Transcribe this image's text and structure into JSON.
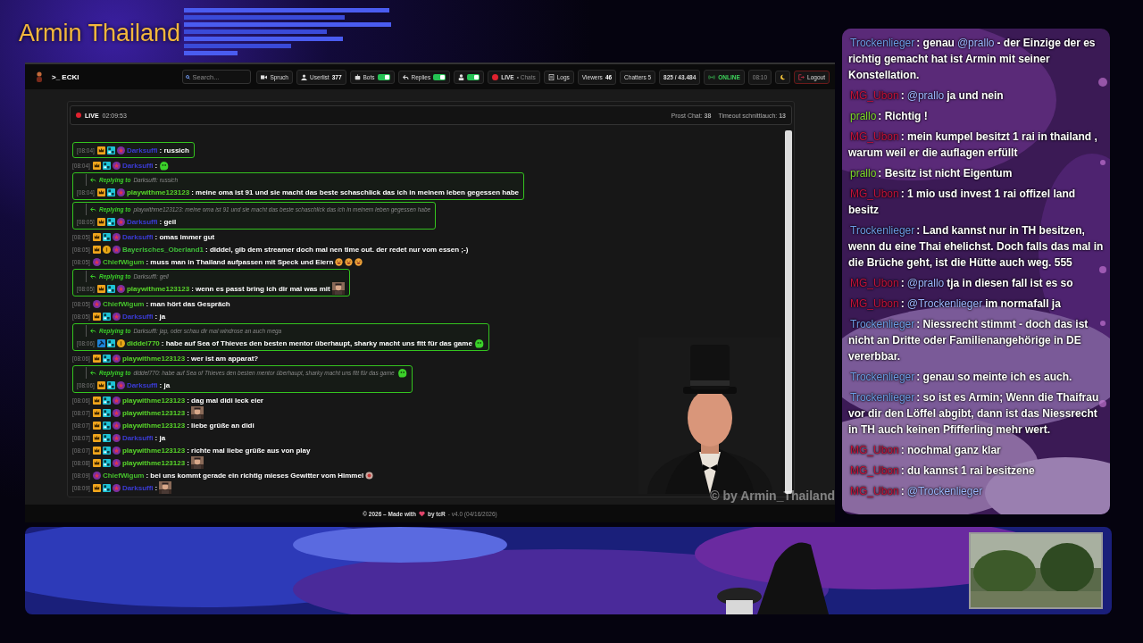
{
  "overlay_title": "Armin Thailand",
  "app": {
    "brand": ">_ ECKI",
    "search": {
      "placeholder": "Search..."
    },
    "toolbar": [
      {
        "kind": "button",
        "label": "Spruch"
      },
      {
        "kind": "stat",
        "label": "Userlist",
        "value": "377"
      },
      {
        "kind": "toggle",
        "label": "Bots",
        "on": true
      },
      {
        "kind": "toggle",
        "label": "Replies",
        "on": true
      },
      {
        "kind": "toggle",
        "on": true
      },
      {
        "kind": "live",
        "label": "LIVE",
        "value": "• Chats"
      },
      {
        "kind": "button",
        "label": "Logs"
      },
      {
        "kind": "stat",
        "label": "Viewers",
        "value": "46"
      },
      {
        "kind": "button",
        "label": "Chatters 5"
      },
      {
        "kind": "stat",
        "label": "825 / 43.484"
      },
      {
        "kind": "status",
        "label": "ONLINE"
      },
      {
        "kind": "clock",
        "label": "08:10"
      },
      {
        "kind": "theme"
      },
      {
        "kind": "logout",
        "label": "Logout"
      }
    ],
    "panel": {
      "live": "LIVE",
      "uptime": "02:09:53",
      "stats": [
        "Prost Chat: **38**",
        "Timeout schnittlauch: **13**"
      ]
    },
    "messages": [
      {
        "time": "[08:04]",
        "badges": [
          {
            "kind": "crown"
          },
          {
            "kind": "grid"
          },
          {
            "kind": "star"
          }
        ],
        "user": "Darksuffi",
        "color": "#3b3bd6",
        "text": ": russich",
        "boxed": true
      },
      {
        "time": "[08:04]",
        "badges": [
          {
            "kind": "crown"
          },
          {
            "kind": "grid"
          },
          {
            "kind": "star"
          }
        ],
        "user": "Darksuffi",
        "color": "#3b3bd6",
        "text": ":",
        "emotes": [
          {
            "kind": "blob"
          }
        ]
      },
      {
        "time": "[08:04]",
        "badges": [
          {
            "kind": "crown"
          },
          {
            "kind": "grid"
          },
          {
            "kind": "star"
          }
        ],
        "user": "playwithme123123",
        "color": "#58d62a",
        "text": ": meine oma ist 91 und sie macht das beste schaschlick das ich in meinem leben gegessen habe",
        "reply": {
          "label": "Replying to",
          "quote": "Darksuffi: russich"
        }
      },
      {
        "time": "[08:05]",
        "badges": [
          {
            "kind": "crown"
          },
          {
            "kind": "grid"
          },
          {
            "kind": "star"
          }
        ],
        "user": "Darksuffi",
        "color": "#3b3bd6",
        "text": ": geil",
        "reply": {
          "label": "Replying to",
          "quote": "playwithme123123: meine oma ist 91 und sie macht das beste schaschlick das ich in meinem leben gegessen habe"
        }
      },
      {
        "time": "[08:05]",
        "badges": [
          {
            "kind": "crown"
          },
          {
            "kind": "grid"
          },
          {
            "kind": "star"
          }
        ],
        "user": "Darksuffi",
        "color": "#3b3bd6",
        "text": ": omas immer gut"
      },
      {
        "time": "[08:05]",
        "badges": [
          {
            "kind": "crown"
          },
          {
            "kind": "coin"
          },
          {
            "kind": "star"
          }
        ],
        "user": "Bayerisches_Oberland1",
        "color": "#3fbf3a",
        "text": ": diddel, gib dem streamer doch mal nen time out. der redet nur vom essen ;-)"
      },
      {
        "time": "[08:05]",
        "badges": [
          {
            "kind": "star"
          }
        ],
        "user": "ChiefWigum",
        "color": "#46c22c",
        "text": ": muss man in Thailand aufpassen mit Speck und Eiern",
        "emotes": [
          {
            "kind": "laugh"
          },
          {
            "kind": "laugh"
          },
          {
            "kind": "laugh"
          }
        ]
      },
      {
        "time": "[08:05]",
        "badges": [
          {
            "kind": "crown"
          },
          {
            "kind": "grid"
          },
          {
            "kind": "star"
          }
        ],
        "user": "playwithme123123",
        "color": "#58d62a",
        "text": ": wenn es passt bring ich dir mal was mit",
        "reply": {
          "label": "Replying to",
          "quote": "Darksuffi: geil"
        }
      },
      {
        "time": "[08:05]",
        "badges": [
          {
            "kind": "star"
          }
        ],
        "user": "ChiefWigum",
        "color": "#46c22c",
        "text": ": man hört das Gespräch"
      },
      {
        "time": "[08:05]",
        "badges": [
          {
            "kind": "crown"
          },
          {
            "kind": "grid"
          },
          {
            "kind": "star"
          }
        ],
        "user": "Darksuffi",
        "color": "#3b3bd6",
        "text": ": ja"
      },
      {
        "time": "[08:06]",
        "badges": [
          {
            "kind": "hammer"
          },
          {
            "kind": "grid"
          },
          {
            "kind": "coin"
          }
        ],
        "user": "diddel770",
        "color": "#58d62a",
        "text": ": habe auf Sea of Thieves den besten mentor überhaupt, sharky macht uns fitt für das game",
        "emotes": [
          {
            "kind": "blob"
          }
        ],
        "reply": {
          "label": "Replying to",
          "quote": "Darksuffi: jap, oder schau dir mal windrose an auch mega"
        }
      },
      {
        "time": "[08:06]",
        "badges": [
          {
            "kind": "crown"
          },
          {
            "kind": "grid"
          },
          {
            "kind": "star"
          }
        ],
        "user": "playwithme123123",
        "color": "#58d62a",
        "text": ": wer ist am apparat?"
      },
      {
        "time": "[08:06]",
        "badges": [
          {
            "kind": "crown"
          },
          {
            "kind": "grid"
          },
          {
            "kind": "star"
          }
        ],
        "user": "Darksuffi",
        "color": "#3b3bd6",
        "text": ": ja",
        "reply": {
          "label": "Replying to",
          "quote": "diddel770: habe auf Sea of Thieves den besten mentor überhaupt, sharky macht uns fitt für das game",
          "emotes": [
            {
              "kind": "blob"
            }
          ]
        }
      },
      {
        "time": "[08:06]",
        "badges": [
          {
            "kind": "crown"
          },
          {
            "kind": "grid"
          },
          {
            "kind": "star"
          }
        ],
        "user": "playwithme123123",
        "color": "#58d62a",
        "text": ": dag mal didi leck eier"
      },
      {
        "time": "[08:07]",
        "badges": [
          {
            "kind": "crown"
          },
          {
            "kind": "grid"
          },
          {
            "kind": "star"
          }
        ],
        "user": "playwithme123123",
        "color": "#58d62a",
        "text": ":"
      },
      {
        "time": "[08:07]",
        "badges": [
          {
            "kind": "crown"
          },
          {
            "kind": "grid"
          },
          {
            "kind": "star"
          }
        ],
        "user": "playwithme123123",
        "color": "#58d62a",
        "text": ": liebe grüße an didi"
      },
      {
        "time": "[08:07]",
        "badges": [
          {
            "kind": "crown"
          },
          {
            "kind": "grid"
          },
          {
            "kind": "star"
          }
        ],
        "user": "Darksuffi",
        "color": "#3b3bd6",
        "text": ": ja"
      },
      {
        "time": "[08:07]",
        "badges": [
          {
            "kind": "crown"
          },
          {
            "kind": "grid"
          },
          {
            "kind": "star"
          }
        ],
        "user": "playwithme123123",
        "color": "#58d62a",
        "text": ": richte mal liebe grüße aus von play"
      },
      {
        "time": "[08:08]",
        "badges": [
          {
            "kind": "crown"
          },
          {
            "kind": "grid"
          },
          {
            "kind": "star"
          }
        ],
        "user": "playwithme123123",
        "color": "#58d62a",
        "text": ":"
      },
      {
        "time": "[08:09]",
        "badges": [
          {
            "kind": "star"
          }
        ],
        "user": "ChiefWigum",
        "color": "#46c22c",
        "text": ": bei uns kommt gerade ein richtig mieses Gewitter vom Himmel",
        "emotes": [
          {
            "kind": "storm"
          }
        ]
      },
      {
        "time": "[08:09]",
        "badges": [
          {
            "kind": "crown"
          },
          {
            "kind": "grid"
          },
          {
            "kind": "star"
          }
        ],
        "user": "Darksuffi",
        "color": "#3b3bd6",
        "text": ":"
      }
    ],
    "footer": {
      "made": "© 2026 – Made with",
      "by": "by tcR",
      "version": "- v4.0 (04/16/2026)"
    }
  },
  "stream_credit": "© by Armin_Thailand",
  "side_chat": [
    {
      "user": "Trockenlieger",
      "color": "#6b9be3",
      "parts": [
        {
          "kind": "text",
          "text": ": genau"
        },
        {
          "kind": "mention",
          "text": "@prallo"
        },
        {
          "kind": "text",
          "text": "- der Einzige der es richtig gemacht hat ist Armin mit seiner Konstellation."
        }
      ]
    },
    {
      "user": "MG_Ubon",
      "color": "#c4123a",
      "parts": [
        {
          "kind": "text",
          "text": ":"
        },
        {
          "kind": "mention",
          "text": "@prallo"
        },
        {
          "kind": "text",
          "text": "ja und nein"
        }
      ]
    },
    {
      "user": "prallo",
      "color": "#7edc2a",
      "parts": [
        {
          "kind": "text",
          "text": ": Richtig !"
        }
      ]
    },
    {
      "user": "MG_Ubon",
      "color": "#c4123a",
      "parts": [
        {
          "kind": "text",
          "text": ": mein kumpel besitzt 1 rai in thailand , warum weil er die auflagen erfüllt"
        }
      ]
    },
    {
      "user": "prallo",
      "color": "#7edc2a",
      "parts": [
        {
          "kind": "text",
          "text": ": Besitz ist nicht Eigentum"
        }
      ]
    },
    {
      "user": "MG_Ubon",
      "color": "#c4123a",
      "parts": [
        {
          "kind": "text",
          "text": ": 1 mio usd invest 1 rai offizel land besitz"
        }
      ]
    },
    {
      "user": "Trockenlieger",
      "color": "#6b9be3",
      "parts": [
        {
          "kind": "text",
          "text": ": Land kannst nur in TH besitzen, wenn du eine Thai ehelichst. Doch falls das mal in die Brüche geht, ist die Hütte auch weg. 555"
        }
      ]
    },
    {
      "user": "MG_Ubon",
      "color": "#c4123a",
      "parts": [
        {
          "kind": "text",
          "text": ":"
        },
        {
          "kind": "mention",
          "text": "@prallo"
        },
        {
          "kind": "text",
          "text": "tja in diesen fall ist es so"
        }
      ]
    },
    {
      "user": "MG_Ubon",
      "color": "#c4123a",
      "parts": [
        {
          "kind": "text",
          "text": ":"
        },
        {
          "kind": "mention",
          "text": "@Trockenlieger"
        },
        {
          "kind": "text",
          "text": "im normafall ja"
        }
      ]
    },
    {
      "user": "Trockenlieger",
      "color": "#6b9be3",
      "parts": [
        {
          "kind": "text",
          "text": ": Niessrecht stimmt - doch das ist nicht an Dritte oder Familienangehörige in DE vererbbar."
        }
      ]
    },
    {
      "user": "Trockenlieger",
      "color": "#6b9be3",
      "parts": [
        {
          "kind": "text",
          "text": ": genau so meinte ich es auch."
        }
      ]
    },
    {
      "user": "Trockenlieger",
      "color": "#6b9be3",
      "parts": [
        {
          "kind": "text",
          "text": ": so ist es Armin; Wenn die Thaifrau vor dir den Löffel abgibt, dann ist das Niessrecht in TH auch keinen Pfifferling mehr wert."
        }
      ]
    },
    {
      "user": "MG_Ubon",
      "color": "#c4123a",
      "parts": [
        {
          "kind": "text",
          "text": ": nochmal ganz klar"
        }
      ]
    },
    {
      "user": "MG_Ubon",
      "color": "#c4123a",
      "parts": [
        {
          "kind": "text",
          "text": ": du kannst 1 rai besitzene"
        }
      ]
    },
    {
      "user": "MG_Ubon",
      "color": "#c4123a",
      "parts": [
        {
          "kind": "text",
          "text": ":"
        },
        {
          "kind": "mention",
          "text": "@Trockenlieger"
        }
      ]
    }
  ]
}
